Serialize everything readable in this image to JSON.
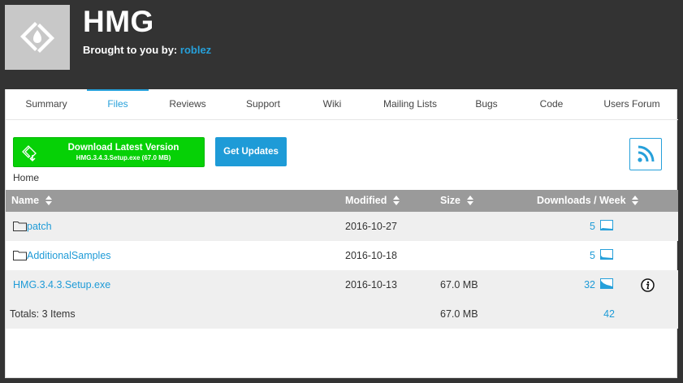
{
  "project": {
    "title": "HMG",
    "brought_prefix": "Brought to you by:",
    "author": "roblez"
  },
  "tabs": [
    {
      "label": "Summary"
    },
    {
      "label": "Files"
    },
    {
      "label": "Reviews"
    },
    {
      "label": "Support"
    },
    {
      "label": "Wiki"
    },
    {
      "label": "Mailing Lists"
    },
    {
      "label": "Bugs"
    },
    {
      "label": "Code"
    },
    {
      "label": "Users Forum"
    }
  ],
  "active_tab": "Files",
  "download": {
    "main_label": "Download Latest Version",
    "file_label": "HMG.3.4.3.Setup.exe (67.0 MB)"
  },
  "updates_label": "Get Updates",
  "breadcrumb": "Home",
  "table": {
    "headers": {
      "name": "Name",
      "modified": "Modified",
      "size": "Size",
      "downloads": "Downloads / Week"
    },
    "rows": [
      {
        "name": "patch",
        "type": "folder",
        "modified": "2016-10-27",
        "size": "",
        "downloads": "5"
      },
      {
        "name": "AdditionalSamples",
        "type": "folder",
        "modified": "2016-10-18",
        "size": "",
        "downloads": "5"
      },
      {
        "name": "HMG.3.4.3.Setup.exe",
        "type": "file",
        "modified": "2016-10-13",
        "size": "67.0 MB",
        "downloads": "32"
      }
    ],
    "totals": {
      "label": "Totals: 3 Items",
      "size": "67.0 MB",
      "downloads": "42"
    }
  },
  "colors": {
    "header_bg": "#333333",
    "accent": "#26a0da",
    "download_green": "#06d106",
    "table_header": "#9a9a9a"
  },
  "icons": [
    "sourceforge-logo-icon",
    "download-icon",
    "rss-icon",
    "sort-icon",
    "folder-icon",
    "sparkline-icon",
    "info-icon"
  ]
}
